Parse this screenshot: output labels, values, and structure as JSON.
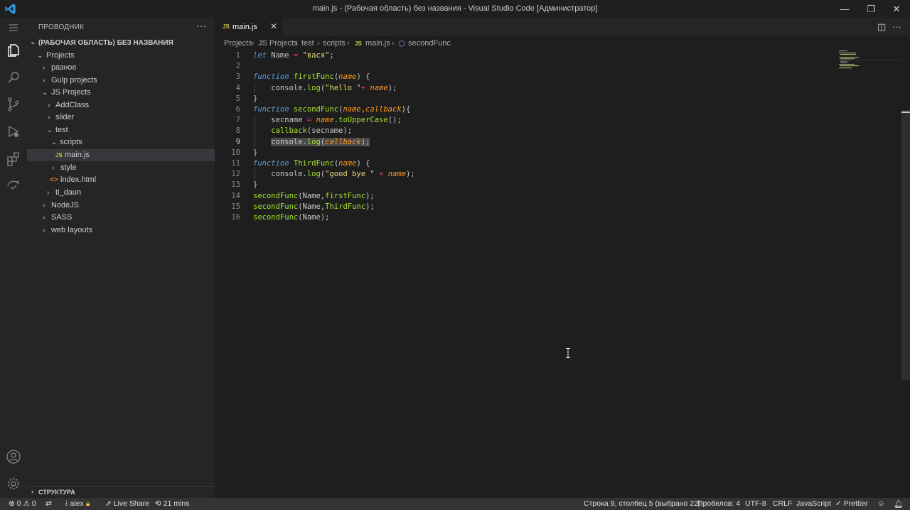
{
  "window": {
    "title": "main.js - (Рабочая область) без названия - Visual Studio Code [Администратор]",
    "controls": {
      "minimize": "—",
      "restore": "❐",
      "close": "✕"
    }
  },
  "activity_bar": {
    "icons": [
      "menu-icon",
      "explorer-icon",
      "search-icon",
      "source-control-icon",
      "run-debug-icon",
      "extensions-icon",
      "remote-explorer-icon",
      "account-icon",
      "settings-gear-icon"
    ]
  },
  "sidebar": {
    "header": "ПРОВОДНИК",
    "more": "···",
    "workspace_label": "(РАБОЧАЯ ОБЛАСТЬ) БЕЗ НАЗВАНИЯ",
    "tree": [
      {
        "label": "Projects",
        "twisty": "⌄"
      },
      {
        "label": "разное",
        "twisty": "›"
      },
      {
        "label": "Gulp projects",
        "twisty": "›"
      },
      {
        "label": "JS Projects",
        "twisty": "⌄"
      },
      {
        "label": "AddClass",
        "twisty": "›"
      },
      {
        "label": "slider",
        "twisty": "›"
      },
      {
        "label": "test",
        "twisty": "⌄"
      },
      {
        "label": "scripts",
        "twisty": "⌄"
      },
      {
        "label": "main.js",
        "icon": "JS",
        "selected": true
      },
      {
        "label": "style",
        "twisty": "›"
      },
      {
        "label": "index.html",
        "icon": "<>"
      },
      {
        "label": "ti_daun",
        "twisty": "›"
      },
      {
        "label": "NodeJS",
        "twisty": "›"
      },
      {
        "label": "SASS",
        "twisty": "›"
      },
      {
        "label": "web layouts",
        "twisty": "›"
      }
    ],
    "outline_label": "СТРУКТУРА"
  },
  "tabs": [
    {
      "icon": "JS",
      "label": "main.js",
      "close": "✕",
      "active": true
    }
  ],
  "tab_actions": {
    "split": "◫",
    "more": "···"
  },
  "breadcrumbs": {
    "items": [
      "Projects",
      "JS Projects",
      "test",
      "scripts",
      "main.js",
      "secondFunc"
    ],
    "file_icon": "JS",
    "symbol_icon": "⬡",
    "separator": "›"
  },
  "editor": {
    "current_line": 9,
    "line_numbers": [
      "1",
      "2",
      "3",
      "4",
      "5",
      "6",
      "7",
      "8",
      "9",
      "10",
      "11",
      "12",
      "13",
      "14",
      "15",
      "16"
    ],
    "lines": [
      [
        {
          "t": "kw",
          "v": "let"
        },
        {
          "t": "dm",
          "v": " Name "
        },
        {
          "t": "op",
          "v": "="
        },
        {
          "t": "dm",
          "v": " "
        },
        {
          "t": "st",
          "v": "\"вася\""
        },
        {
          "t": "dm",
          "v": ";"
        }
      ],
      [],
      [
        {
          "t": "kw",
          "v": "function"
        },
        {
          "t": "dm",
          "v": " "
        },
        {
          "t": "fn",
          "v": "firstFunc"
        },
        {
          "t": "dm",
          "v": "("
        },
        {
          "t": "pr",
          "v": "name"
        },
        {
          "t": "dm",
          "v": ") {"
        }
      ],
      [
        {
          "t": "dm",
          "v": "    console."
        },
        {
          "t": "fn",
          "v": "log"
        },
        {
          "t": "dm",
          "v": "("
        },
        {
          "t": "st",
          "v": "\"hello \""
        },
        {
          "t": "op",
          "v": "+"
        },
        {
          "t": "dm",
          "v": " "
        },
        {
          "t": "pr",
          "v": "name"
        },
        {
          "t": "dm",
          "v": ");"
        }
      ],
      [
        {
          "t": "dm",
          "v": "}"
        }
      ],
      [
        {
          "t": "kw",
          "v": "function"
        },
        {
          "t": "dm",
          "v": " "
        },
        {
          "t": "fn",
          "v": "secondFunc"
        },
        {
          "t": "dm",
          "v": "("
        },
        {
          "t": "pr",
          "v": "name"
        },
        {
          "t": "dm",
          "v": ","
        },
        {
          "t": "pr",
          "v": "callback"
        },
        {
          "t": "dm",
          "v": "){"
        }
      ],
      [
        {
          "t": "dm",
          "v": "    secname "
        },
        {
          "t": "op",
          "v": "="
        },
        {
          "t": "dm",
          "v": " "
        },
        {
          "t": "pr",
          "v": "name"
        },
        {
          "t": "dm",
          "v": "."
        },
        {
          "t": "fn",
          "v": "toUpperCase"
        },
        {
          "t": "dm",
          "v": "();"
        }
      ],
      [
        {
          "t": "dm",
          "v": "    "
        },
        {
          "t": "fn",
          "v": "callback"
        },
        {
          "t": "dm",
          "v": "(secname);"
        }
      ],
      [
        {
          "t": "dm",
          "v": "    "
        },
        {
          "t": "sel",
          "v": "console.log(callback);"
        }
      ],
      [
        {
          "t": "dm",
          "v": "}"
        }
      ],
      [
        {
          "t": "kw",
          "v": "function"
        },
        {
          "t": "dm",
          "v": " "
        },
        {
          "t": "fn",
          "v": "ThirdFunc"
        },
        {
          "t": "dm",
          "v": "("
        },
        {
          "t": "pr",
          "v": "name"
        },
        {
          "t": "dm",
          "v": ") {"
        }
      ],
      [
        {
          "t": "dm",
          "v": "    console."
        },
        {
          "t": "fn",
          "v": "log"
        },
        {
          "t": "dm",
          "v": "("
        },
        {
          "t": "st",
          "v": "\"good bye \""
        },
        {
          "t": "dm",
          "v": " "
        },
        {
          "t": "op",
          "v": "+"
        },
        {
          "t": "dm",
          "v": " "
        },
        {
          "t": "pr",
          "v": "name"
        },
        {
          "t": "dm",
          "v": ");"
        }
      ],
      [
        {
          "t": "dm",
          "v": "}"
        }
      ],
      [
        {
          "t": "fn",
          "v": "secondFunc"
        },
        {
          "t": "dm",
          "v": "(Name,"
        },
        {
          "t": "fn",
          "v": "firstFunc"
        },
        {
          "t": "dm",
          "v": ");"
        }
      ],
      [
        {
          "t": "fn",
          "v": "secondFunc"
        },
        {
          "t": "dm",
          "v": "(Name,"
        },
        {
          "t": "fn",
          "v": "ThirdFunc"
        },
        {
          "t": "dm",
          "v": ");"
        }
      ],
      [
        {
          "t": "fn",
          "v": "secondFunc"
        },
        {
          "t": "dm",
          "v": "(Name);"
        }
      ]
    ]
  },
  "status_bar": {
    "errors": "0",
    "warnings": "0",
    "user": "alex",
    "live_share": "Live Share",
    "timer": "21 mins",
    "cursor_position": "Строка 9, столбец 5 (выбрано 22)",
    "indentation": "Пробелов: 4",
    "encoding": "UTF-8",
    "eol": "CRLF",
    "language": "JavaScript",
    "formatter": "Prettier"
  },
  "colors": {
    "accent": "#007acc",
    "editor_bg": "#1e1e1e",
    "sidebar_bg": "#252526",
    "statusbar_bg": "#333333",
    "keyword": "#569cd6",
    "function": "#a6e22e",
    "parameter": "#fd971f",
    "string": "#e6db74",
    "operator": "#f92672"
  }
}
